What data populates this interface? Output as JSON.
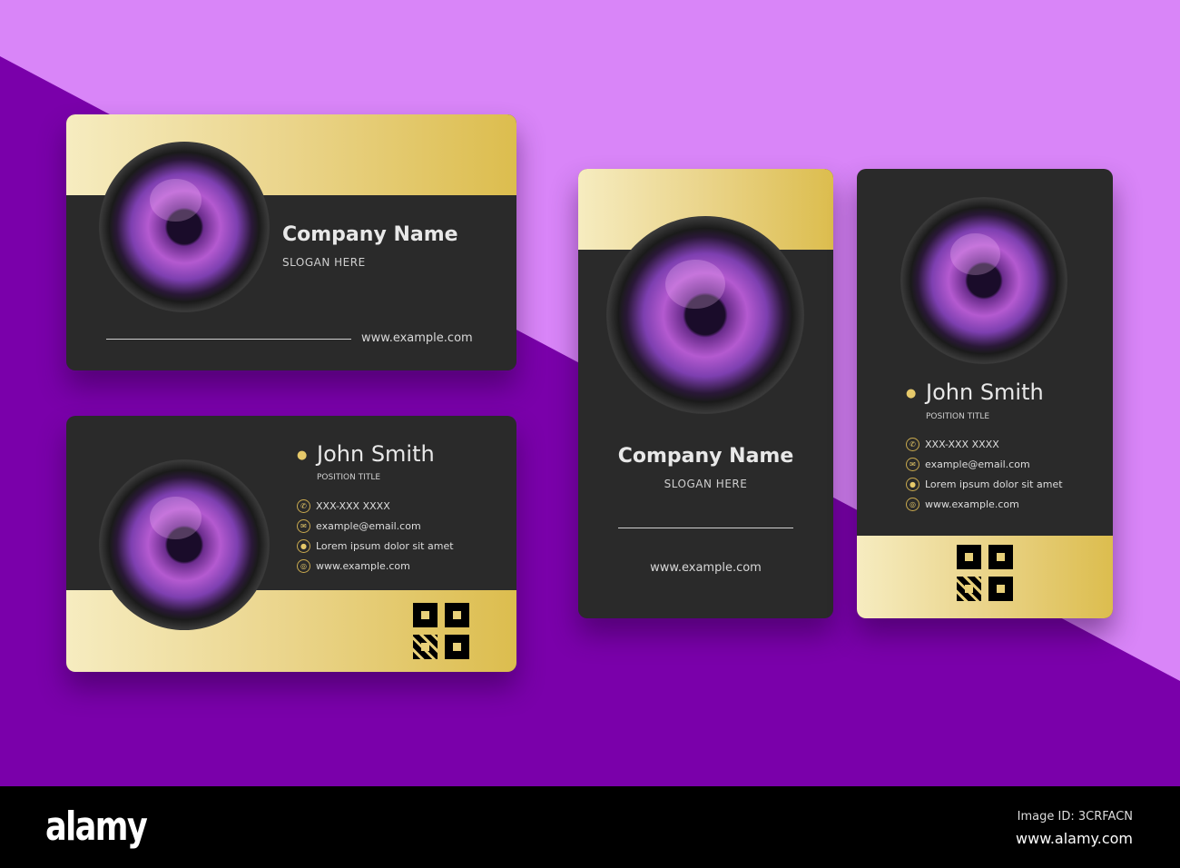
{
  "colors": {
    "bg_light": "#d985f8",
    "bg_dark": "#7a00aa",
    "card": "#2a2a2a",
    "gold": "#ead48a"
  },
  "front_horizontal": {
    "company_name": "Company Name",
    "slogan": "SLOGAN HERE",
    "website": "www.example.com"
  },
  "back_horizontal": {
    "name": "John Smith",
    "position": "POSITION TITLE",
    "contacts": [
      {
        "icon": "phone-icon",
        "text": "XXX-XXX XXXX"
      },
      {
        "icon": "mail-icon",
        "text": "example@email.com"
      },
      {
        "icon": "location-icon",
        "text": "Lorem ipsum dolor sit amet"
      },
      {
        "icon": "globe-icon",
        "text": "www.example.com"
      }
    ]
  },
  "front_vertical": {
    "company_name": "Company Name",
    "slogan": "SLOGAN HERE",
    "website": "www.example.com"
  },
  "back_vertical": {
    "name": "John Smith",
    "position": "POSITION TITLE",
    "contacts": [
      {
        "icon": "phone-icon",
        "text": "XXX-XXX XXXX"
      },
      {
        "icon": "mail-icon",
        "text": "example@email.com"
      },
      {
        "icon": "location-icon",
        "text": "Lorem ipsum dolor sit amet"
      },
      {
        "icon": "globe-icon",
        "text": "www.example.com"
      }
    ]
  },
  "footer": {
    "logo": "alamy",
    "image_id": "Image ID: 3CRFACN",
    "site": "www.alamy.com"
  }
}
